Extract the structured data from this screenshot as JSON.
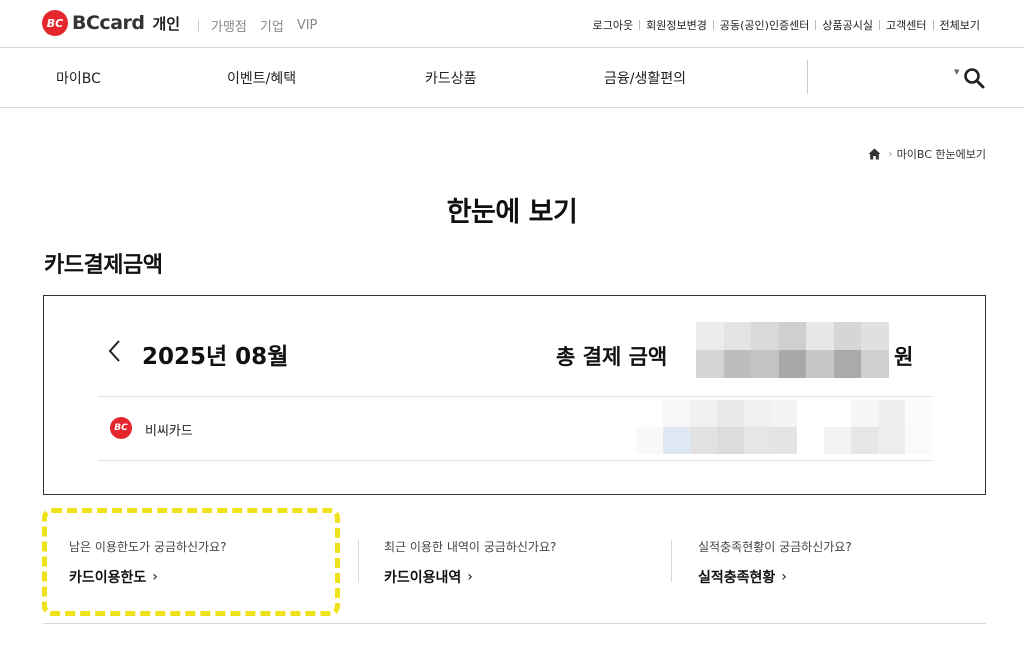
{
  "header": {
    "brand": "BCcard",
    "segment": "개인",
    "segment_links": [
      "가맹점",
      "기업",
      "VIP"
    ],
    "utility_links": [
      "로그아웃",
      "회원정보변경",
      "공동(공인)인증센터",
      "상품공시실",
      "고객센터",
      "전체보기"
    ]
  },
  "gnb": {
    "menu": [
      "마이BC",
      "이벤트/혜택",
      "카드상품",
      "금융/생활편의"
    ]
  },
  "breadcrumb": [
    "마이BC 한눈에보기"
  ],
  "page_title": "한눈에 보기",
  "section_title": "카드결제금액",
  "payment": {
    "month": "2025년 08월",
    "total_label": "총 결제 금액",
    "total_unit": "원",
    "cards": [
      {
        "name": "비씨카드"
      }
    ]
  },
  "links": [
    {
      "question": "남은 이용한도가 궁금하신가요?",
      "title": "카드이용한도",
      "arrow": "›",
      "highlighted": true
    },
    {
      "question": "최근 이용한 내역이 궁금하신가요?",
      "title": "카드이용내역",
      "arrow": "›"
    },
    {
      "question": "실적충족현황이 궁금하신가요?",
      "title": "실적충족현황",
      "arrow": "›"
    }
  ],
  "colors": {
    "brand_red": "#e5262c",
    "highlight_yellow": "#f0e21a"
  },
  "icons": {
    "logo": "bc-logo-icon",
    "search": "search-icon",
    "home": "home-icon",
    "prev": "chevron-left-icon"
  }
}
